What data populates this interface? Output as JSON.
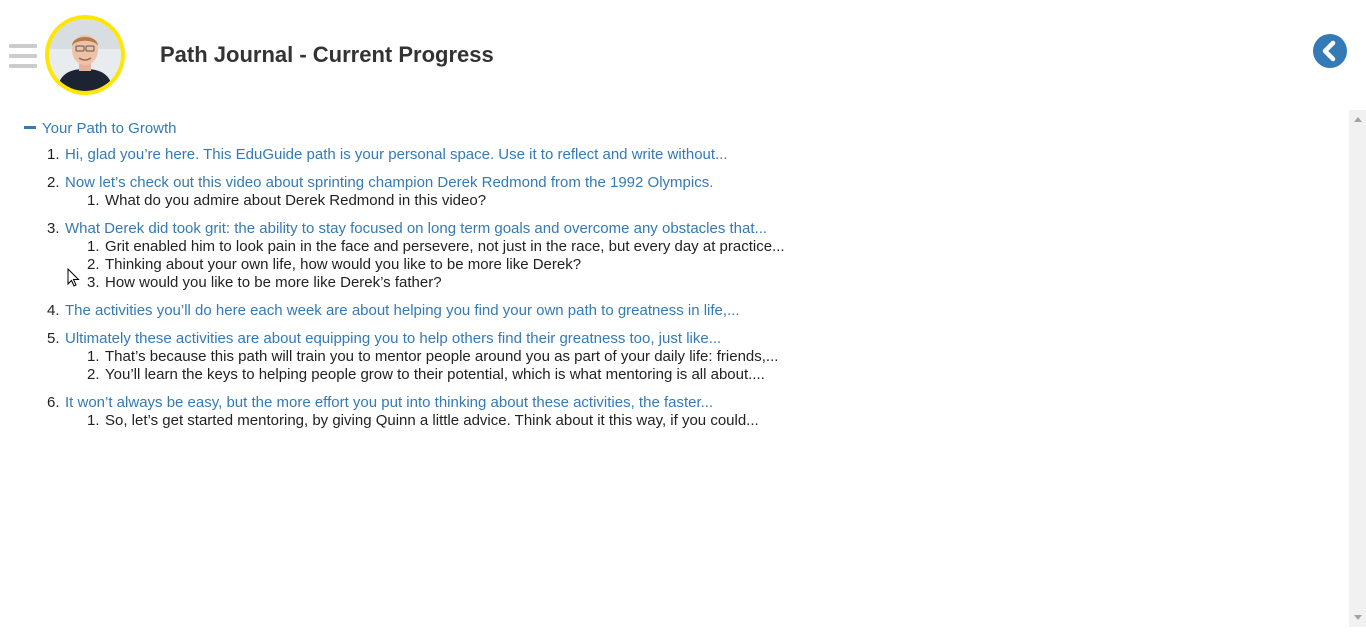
{
  "header": {
    "title": "Path Journal - Current Progress",
    "avatar_icon": "user-avatar-photo",
    "menu_icon": "hamburger-menu-icon",
    "back_icon": "chevron-left-circle-icon",
    "accent_color": "#337ab7",
    "avatar_ring_color": "#ffe600"
  },
  "section": {
    "toggle_label": "Your Path to Growth",
    "toggle_icon": "minus-icon"
  },
  "items": [
    {
      "num": "1.",
      "text": "Hi, glad you’re here. This EduGuide path is your personal space. Use it to reflect and write without...",
      "children": []
    },
    {
      "num": "2.",
      "text": "Now let’s check out this video about sprinting champion Derek Redmond from the 1992 Olympics.",
      "children": [
        {
          "num": "1.",
          "text": "What do you admire about Derek Redmond in this video?"
        }
      ]
    },
    {
      "num": "3.",
      "text": "What Derek did took grit: the ability to stay focused on long term goals and overcome any obstacles that...",
      "children": [
        {
          "num": "1.",
          "text": "Grit enabled him to look pain in the face and persevere, not just in the race, but every day at practice..."
        },
        {
          "num": "2.",
          "text": "Thinking about your own life, how would you like to be more like Derek?"
        },
        {
          "num": "3.",
          "text": "How would you like to be more like Derek’s father?"
        }
      ]
    },
    {
      "num": "4.",
      "text": "The activities you’ll do here each week are about helping you find your own path to greatness in life,...",
      "children": []
    },
    {
      "num": "5.",
      "text": "Ultimately these activities are about equipping you to help others find their greatness too, just like...",
      "children": [
        {
          "num": "1.",
          "text": "That’s because this path will train you to mentor people around you as part of your daily life: friends,..."
        },
        {
          "num": "2.",
          "text": "You’ll learn the keys to helping people grow to their potential, which is what mentoring is all about...."
        }
      ]
    },
    {
      "num": "6.",
      "text": "It won’t always be easy, but the more effort you put into thinking about these activities, the faster...",
      "children": [
        {
          "num": "1.",
          "text": "So, let’s get started mentoring, by giving Quinn a little advice. Think about it this way, if you could..."
        }
      ]
    }
  ]
}
